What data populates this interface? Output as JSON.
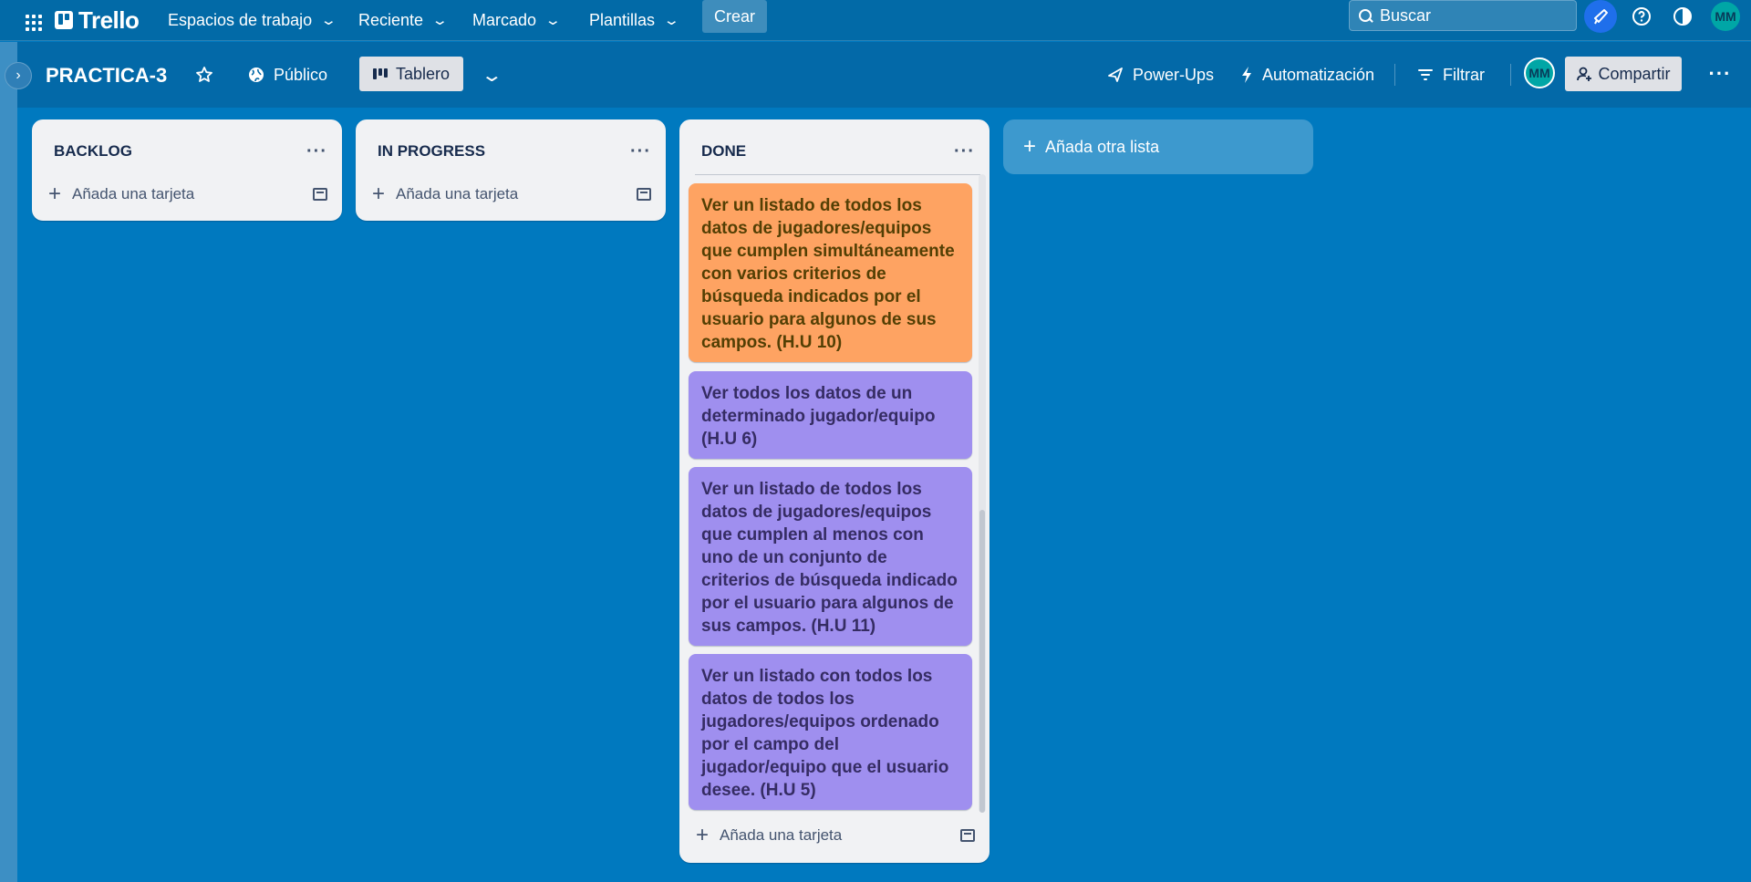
{
  "app": {
    "brand": "Trello",
    "nav": {
      "workspaces": "Espacios de trabajo",
      "recent": "Reciente",
      "starred": "Marcado",
      "templates": "Plantillas",
      "create": "Crear"
    },
    "search": {
      "placeholder": "Buscar"
    },
    "user_initials": "MM"
  },
  "board": {
    "title": "PRACTICA-3",
    "visibility": "Público",
    "view": "Tablero",
    "powerups": "Power-Ups",
    "automation": "Automatización",
    "filter": "Filtrar",
    "share": "Compartir",
    "member_initials": "MM"
  },
  "lists": [
    {
      "title": "BACKLOG",
      "add_card": "Añada una tarjeta",
      "cards": []
    },
    {
      "title": "IN PROGRESS",
      "add_card": "Añada una tarjeta",
      "cards": []
    },
    {
      "title": "DONE",
      "add_card": "Añada una tarjeta",
      "cards": [
        {
          "text": "Ver un listado de todos los datos de jugadores/equipos que cumplen simultáneamente con varios criterios de búsqueda indicados por el usuario para algunos de sus campos. (H.U 10)",
          "color": "#fea362"
        },
        {
          "text": "Ver todos los datos de un determinado jugador/equipo (H.U 6)",
          "color": "#9f8fef"
        },
        {
          "text": "Ver un listado de todos los datos de jugadores/equipos que cumplen al menos con uno de un conjunto de criterios de búsqueda indicado por el usuario para algunos de sus campos. (H.U 11)",
          "color": "#9f8fef"
        },
        {
          "text": "Ver un listado con todos los datos de todos los jugadores/equipos ordenado por el campo del jugador/equipo que el usuario desee. (H.U 5)",
          "color": "#9f8fef"
        }
      ]
    }
  ],
  "add_list": "Añada otra lista",
  "colors": {
    "board_bg": "#0079bf",
    "topbar_bg": "#026aa7",
    "card_orange": "#fea362",
    "card_purple": "#9f8fef"
  }
}
